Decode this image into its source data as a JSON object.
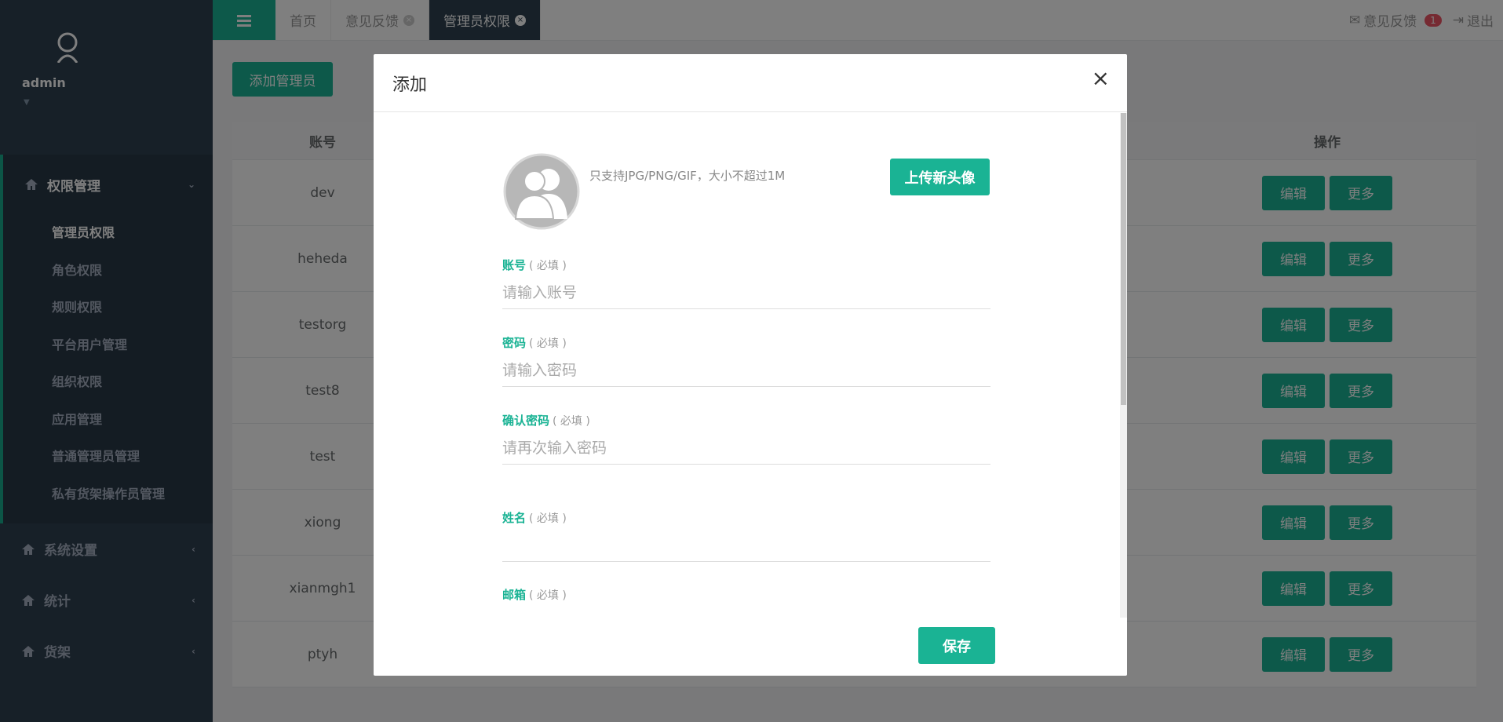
{
  "sidebar": {
    "username": "admin",
    "groups": [
      {
        "label": "权限管理",
        "items": [
          "管理员权限",
          "角色权限",
          "规则权限",
          "平台用户管理",
          "组织权限",
          "应用管理",
          "普通管理员管理",
          "私有货架操作员管理"
        ]
      }
    ],
    "other_items": [
      "系统设置",
      "统计",
      "货架"
    ]
  },
  "topbar": {
    "tabs": [
      "首页",
      "意见反馈",
      "管理员权限"
    ],
    "feedback_label": "意见反馈",
    "feedback_count": "1",
    "logout_label": "退出"
  },
  "content": {
    "add_admin_label": "添加管理员",
    "col_account": "账号",
    "col_ops": "操作",
    "rows": [
      "dev",
      "heheda",
      "testorg",
      "test8",
      "test",
      "xiong",
      "xianmgh1",
      "ptyh"
    ],
    "edit_label": "编辑",
    "more_label": "更多"
  },
  "modal": {
    "title": "添加",
    "close": "×",
    "upload_hint": "只支持JPG/PNG/GIF，大小不超过1M",
    "upload_label": "上传新头像",
    "required": "( 必填 )",
    "fields": [
      {
        "label": "账号",
        "placeholder": "请输入账号"
      },
      {
        "label": "密码",
        "placeholder": "请输入密码"
      },
      {
        "label": "确认密码",
        "placeholder": "请再次输入密码"
      },
      {
        "label": "姓名",
        "placeholder": ""
      },
      {
        "label": "邮箱",
        "placeholder": ""
      }
    ],
    "save_label": "保存"
  },
  "colors": {
    "primary": "#1ab394",
    "sidebar": "#2f4050",
    "badge": "#ed5565"
  }
}
